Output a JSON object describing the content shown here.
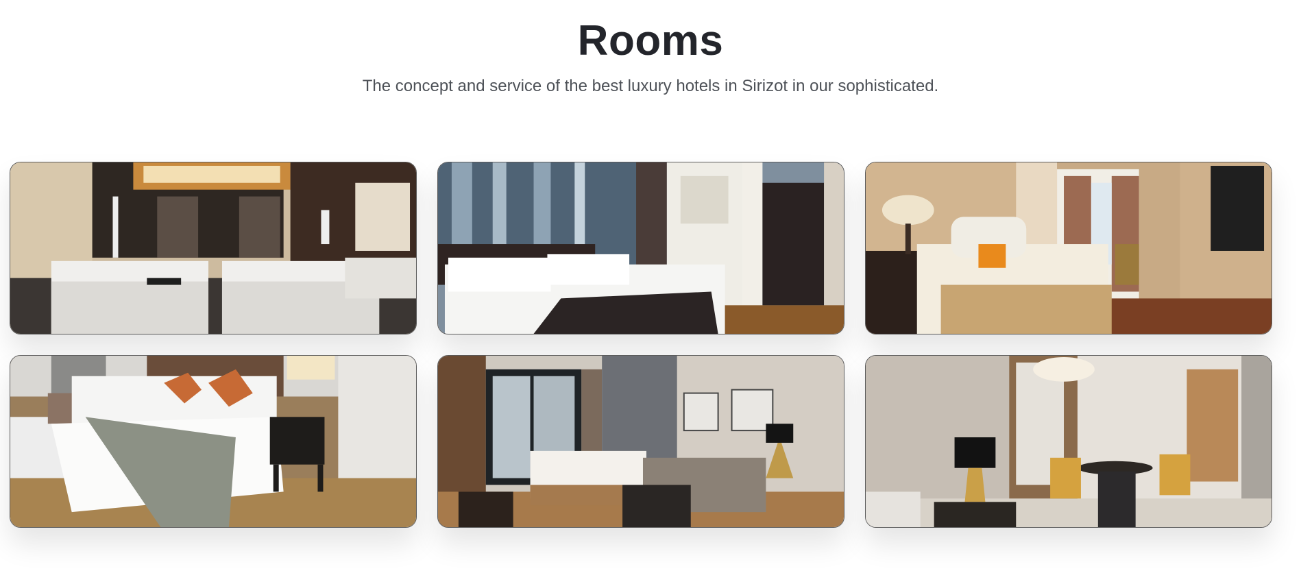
{
  "header": {
    "title": "Rooms",
    "subtitle": "The concept and service of the best luxury hotels in Sirizot in our sophisticated."
  },
  "rooms": [
    {
      "name": "room-photo-twin-beds"
    },
    {
      "name": "room-photo-king-bed-bathroom"
    },
    {
      "name": "room-photo-classic-suite"
    },
    {
      "name": "room-photo-deluxe-king"
    },
    {
      "name": "room-photo-studio-living"
    },
    {
      "name": "room-photo-dining-suite"
    }
  ]
}
